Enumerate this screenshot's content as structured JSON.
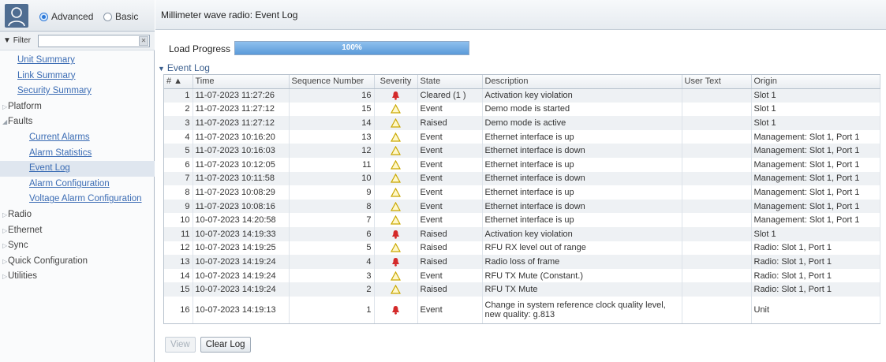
{
  "sidebar": {
    "mode_options": [
      {
        "label": "Advanced",
        "selected": true
      },
      {
        "label": "Basic",
        "selected": false
      }
    ],
    "filter_label": "Filter",
    "nav": [
      {
        "label": "Unit Summary",
        "kind": "l1"
      },
      {
        "label": "Link Summary",
        "kind": "l1"
      },
      {
        "label": "Security Summary",
        "kind": "l1"
      },
      {
        "label": "Platform",
        "kind": "sec",
        "expanded": false
      },
      {
        "label": "Faults",
        "kind": "sec",
        "expanded": true
      },
      {
        "label": "Current Alarms",
        "kind": "l2"
      },
      {
        "label": "Alarm Statistics",
        "kind": "l2"
      },
      {
        "label": "Event Log",
        "kind": "l2",
        "selected": true
      },
      {
        "label": "Alarm Configuration",
        "kind": "l2"
      },
      {
        "label": "Voltage Alarm Configuration",
        "kind": "l2"
      },
      {
        "label": "Radio",
        "kind": "sec",
        "expanded": false
      },
      {
        "label": "Ethernet",
        "kind": "sec",
        "expanded": false
      },
      {
        "label": "Sync",
        "kind": "sec",
        "expanded": false
      },
      {
        "label": "Quick Configuration",
        "kind": "sec",
        "expanded": false
      },
      {
        "label": "Utilities",
        "kind": "sec",
        "expanded": false
      }
    ]
  },
  "main": {
    "title": "Millimeter wave radio: Event Log",
    "load_label": "Load Progress",
    "progress_fraction": 1.0,
    "progress_text": "100%",
    "section_title": "Event Log",
    "columns": [
      "# ▲",
      "Time",
      "Sequence Number",
      "Severity",
      "State",
      "Description",
      "User Text",
      "Origin"
    ],
    "rows": [
      {
        "n": "1",
        "time": "11-07-2023 11:27:26",
        "seq": "16",
        "sev": "critical",
        "state": "Cleared (1 )",
        "desc": "Activation key violation",
        "user": "",
        "origin": "Slot 1"
      },
      {
        "n": "2",
        "time": "11-07-2023 11:27:12",
        "seq": "15",
        "sev": "warning",
        "state": "Event",
        "desc": "Demo mode is started",
        "user": "",
        "origin": "Slot 1"
      },
      {
        "n": "3",
        "time": "11-07-2023 11:27:12",
        "seq": "14",
        "sev": "warning",
        "state": "Raised",
        "desc": "Demo mode is active",
        "user": "",
        "origin": "Slot 1"
      },
      {
        "n": "4",
        "time": "11-07-2023 10:16:20",
        "seq": "13",
        "sev": "warning",
        "state": "Event",
        "desc": "Ethernet interface is up",
        "user": "",
        "origin": "Management: Slot 1, Port 1"
      },
      {
        "n": "5",
        "time": "11-07-2023 10:16:03",
        "seq": "12",
        "sev": "warning",
        "state": "Event",
        "desc": "Ethernet interface is down",
        "user": "",
        "origin": "Management: Slot 1, Port 1"
      },
      {
        "n": "6",
        "time": "11-07-2023 10:12:05",
        "seq": "11",
        "sev": "warning",
        "state": "Event",
        "desc": "Ethernet interface is up",
        "user": "",
        "origin": "Management: Slot 1, Port 1"
      },
      {
        "n": "7",
        "time": "11-07-2023 10:11:58",
        "seq": "10",
        "sev": "warning",
        "state": "Event",
        "desc": "Ethernet interface is down",
        "user": "",
        "origin": "Management: Slot 1, Port 1"
      },
      {
        "n": "8",
        "time": "11-07-2023 10:08:29",
        "seq": "9",
        "sev": "warning",
        "state": "Event",
        "desc": "Ethernet interface is up",
        "user": "",
        "origin": "Management: Slot 1, Port 1"
      },
      {
        "n": "9",
        "time": "11-07-2023 10:08:16",
        "seq": "8",
        "sev": "warning",
        "state": "Event",
        "desc": "Ethernet interface is down",
        "user": "",
        "origin": "Management: Slot 1, Port 1"
      },
      {
        "n": "10",
        "time": "10-07-2023 14:20:58",
        "seq": "7",
        "sev": "warning",
        "state": "Event",
        "desc": "Ethernet interface is up",
        "user": "",
        "origin": "Management: Slot 1, Port 1"
      },
      {
        "n": "11",
        "time": "10-07-2023 14:19:33",
        "seq": "6",
        "sev": "critical",
        "state": "Raised",
        "desc": "Activation key violation",
        "user": "",
        "origin": "Slot 1"
      },
      {
        "n": "12",
        "time": "10-07-2023 14:19:25",
        "seq": "5",
        "sev": "warning",
        "state": "Raised",
        "desc": "RFU RX level out of range",
        "user": "",
        "origin": "Radio: Slot 1, Port 1"
      },
      {
        "n": "13",
        "time": "10-07-2023 14:19:24",
        "seq": "4",
        "sev": "critical",
        "state": "Raised",
        "desc": "Radio loss of frame",
        "user": "",
        "origin": "Radio: Slot 1, Port 1"
      },
      {
        "n": "14",
        "time": "10-07-2023 14:19:24",
        "seq": "3",
        "sev": "warning",
        "state": "Event",
        "desc": "RFU TX Mute (Constant.)",
        "user": "",
        "origin": "Radio: Slot 1, Port 1"
      },
      {
        "n": "15",
        "time": "10-07-2023 14:19:24",
        "seq": "2",
        "sev": "warning",
        "state": "Raised",
        "desc": "RFU TX Mute",
        "user": "",
        "origin": "Radio: Slot 1, Port 1"
      },
      {
        "n": "16",
        "time": "10-07-2023 14:19:13",
        "seq": "1",
        "sev": "critical",
        "state": "Event",
        "desc": "Change in system reference clock quality level, new quality: g.813",
        "user": "",
        "origin": "Unit"
      }
    ],
    "buttons": {
      "view": "View",
      "clear": "Clear Log"
    }
  },
  "colors": {
    "accent": "#2a77d8",
    "link": "#3b6cb4",
    "critical": "#d42a2a",
    "warning": "#f3d21a"
  }
}
